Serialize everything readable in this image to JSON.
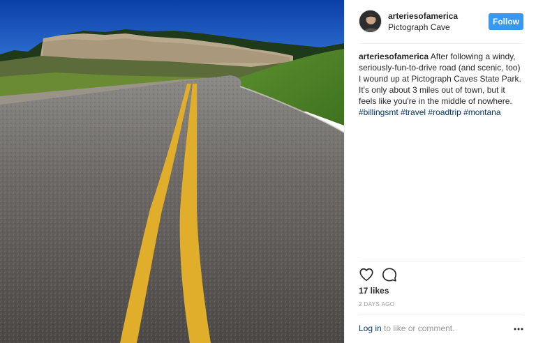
{
  "post": {
    "username": "arteriesofamerica",
    "location": "Pictograph Cave",
    "follow_label": "Follow",
    "caption": {
      "user": "arteriesofamerica",
      "text": " After following a windy, seriously-fun-to-drive road (and scenic, too) I wound up at Pictograph Caves State Park. It's only about 3 miles out of town, but it feels like you're in the middle of nowhere. ",
      "hashtags": [
        "#billingsmt",
        "#travel",
        "#roadtrip",
        "#montana"
      ]
    },
    "likes": "17 likes",
    "timestamp": "2 DAYS AGO",
    "login_link": "Log in",
    "login_rest": " to like or comment."
  },
  "icons": {
    "like": "heart-icon",
    "comment": "comment-icon",
    "more": "more-options-icon"
  },
  "colors": {
    "follow_button": "#3897f0",
    "link": "#003569",
    "muted": "#999999"
  }
}
